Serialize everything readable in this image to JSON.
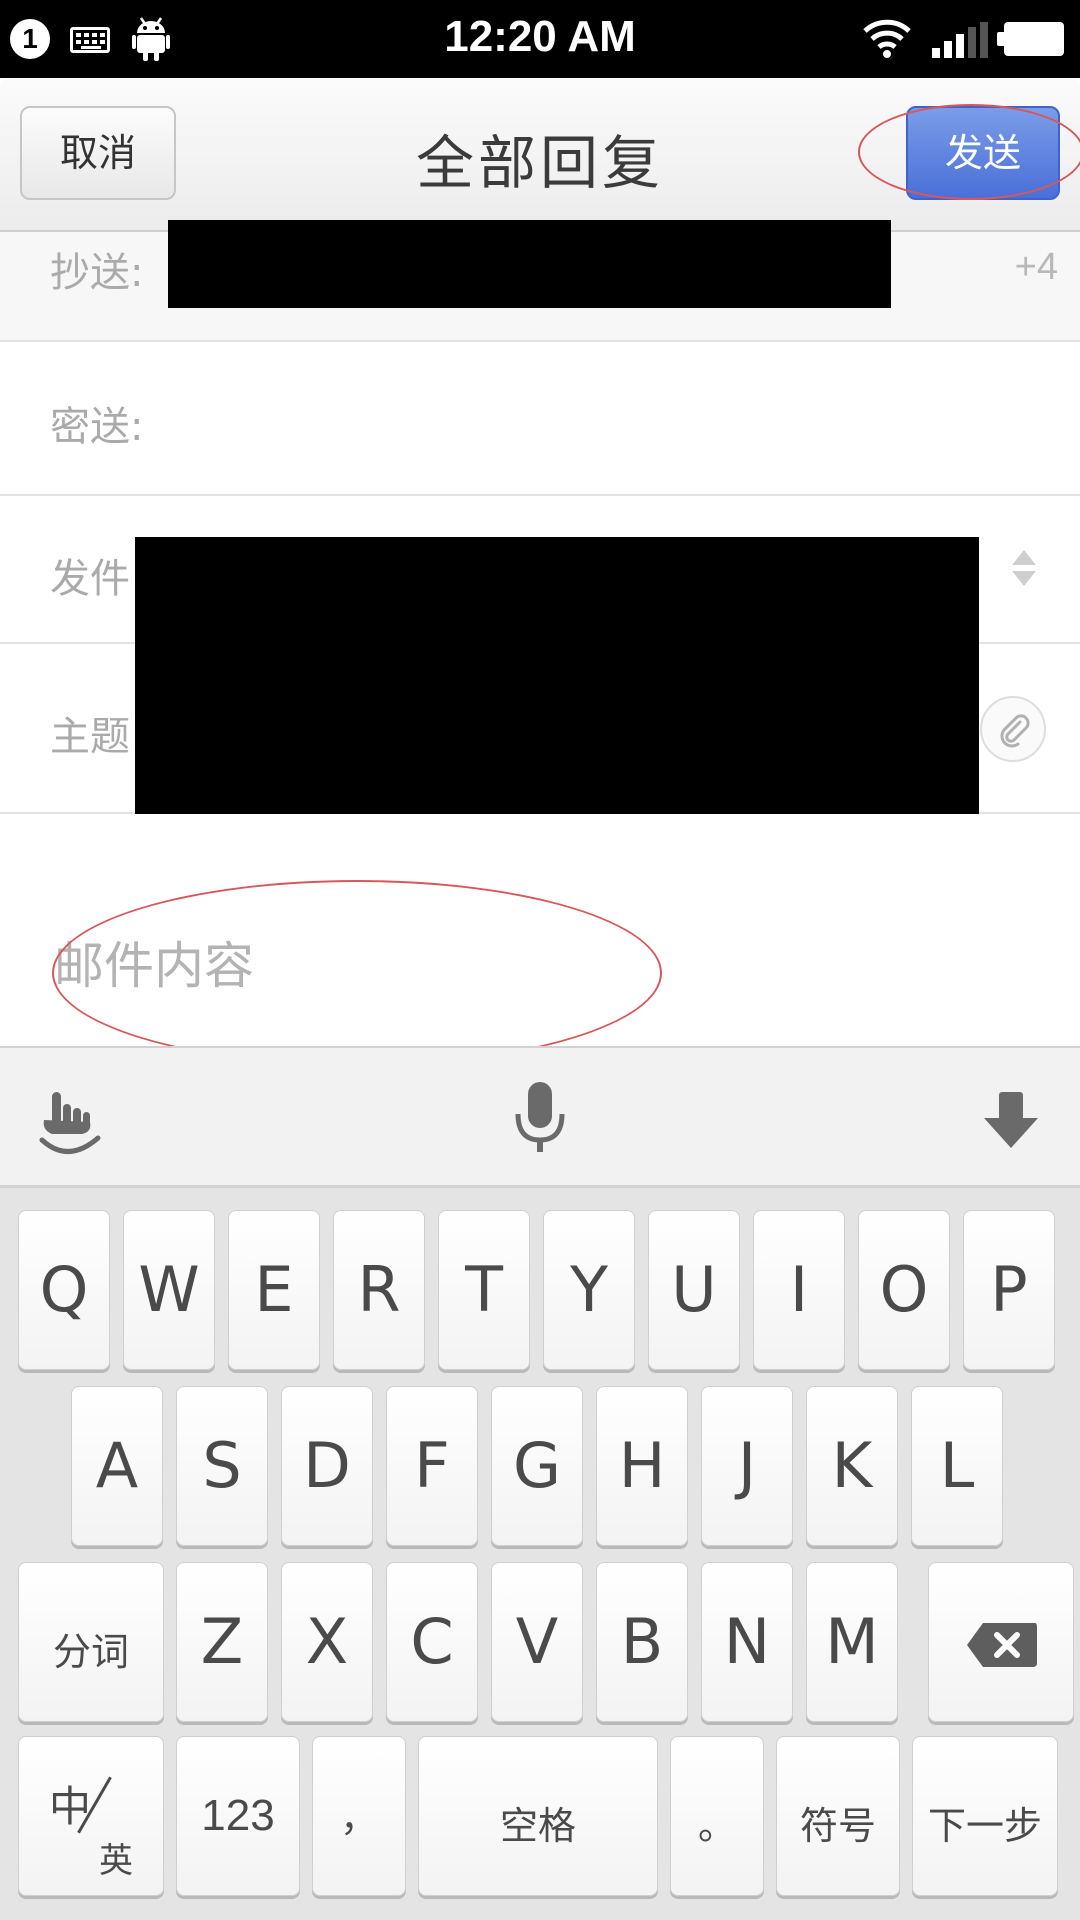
{
  "status_bar": {
    "notification_count": "1",
    "time": "12:20 AM"
  },
  "header": {
    "cancel_label": "取消",
    "title": "全部回复",
    "send_label": "发送"
  },
  "form": {
    "cc_label": "抄送:",
    "cc_more_count": "+4",
    "bcc_label": "密送:",
    "sender_label": "发件",
    "subject_label": "主题",
    "body_placeholder": "邮件内容"
  },
  "keyboard": {
    "row1": [
      "Q",
      "W",
      "E",
      "R",
      "T",
      "Y",
      "U",
      "I",
      "O",
      "P"
    ],
    "row2": [
      "A",
      "S",
      "D",
      "F",
      "G",
      "H",
      "J",
      "K",
      "L"
    ],
    "row3": [
      "Z",
      "X",
      "C",
      "V",
      "B",
      "N",
      "M"
    ],
    "segment_label": "分词",
    "lang_main": "中",
    "lang_sub": "英",
    "num_label": "123",
    "comma_label": "，",
    "space_label": "空格",
    "period_label": "。",
    "symbol_label": "符号",
    "next_label": "下一步"
  },
  "colors": {
    "send_button": "#4a70d8",
    "highlight_circle": "#d9575b",
    "label_gray": "#aaaaaa"
  },
  "icons": [
    "keyboard-icon",
    "android-icon",
    "wifi-icon",
    "signal-icon",
    "battery-icon",
    "sort-arrows-icon",
    "paperclip-icon",
    "gesture-icon",
    "microphone-icon",
    "hide-keyboard-icon",
    "backspace-icon"
  ]
}
